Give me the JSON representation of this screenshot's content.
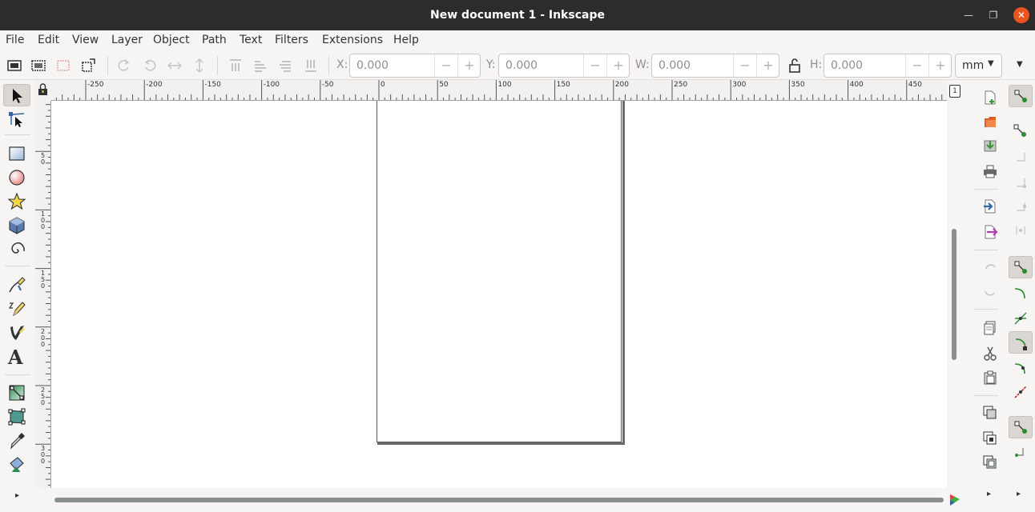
{
  "window": {
    "title": "New document 1 - Inkscape",
    "minimize_glyph": "—",
    "maximize_glyph": "❐",
    "close_glyph": "✕"
  },
  "menu": [
    "File",
    "Edit",
    "View",
    "Layer",
    "Object",
    "Path",
    "Text",
    "Filters",
    "Extensions",
    "Help"
  ],
  "select_toolbar": {
    "x_label": "X:",
    "x_value": "0.000",
    "y_label": "Y:",
    "y_value": "0.000",
    "w_label": "W:",
    "w_value": "0.000",
    "h_label": "H:",
    "h_value": "0.000",
    "minus": "−",
    "plus": "+",
    "unit": "mm",
    "dropdown_caret": "▼",
    "overflow_caret": "▼"
  },
  "ruler": {
    "top_labels": [
      "-250",
      "-200",
      "-150",
      "-100",
      "-50",
      "0",
      "50",
      "100",
      "150",
      "200",
      "250",
      "300",
      "350",
      "400",
      "450"
    ],
    "left_labels": [
      "50",
      "100",
      "150",
      "200",
      "250",
      "300"
    ]
  },
  "tools": [
    "selector-tool",
    "node-tool",
    "rectangle-tool",
    "ellipse-tool",
    "star-tool",
    "3d-box-tool",
    "spiral-tool",
    "pen-tool",
    "pencil-tool",
    "calligraphy-tool",
    "text-tool",
    "gradient-tool",
    "mesh-tool",
    "dropper-tool",
    "paint-bucket-tool"
  ],
  "text_tool_glyph": "A",
  "layer_indicator": "1",
  "expand_glyph": "▸",
  "colors": {
    "titlebar": "#2c2c2c",
    "close_button": "#e95420",
    "canvas": "#ffffff",
    "page_border": "#5a5a5a",
    "snap_green": "#2e8b2e"
  }
}
